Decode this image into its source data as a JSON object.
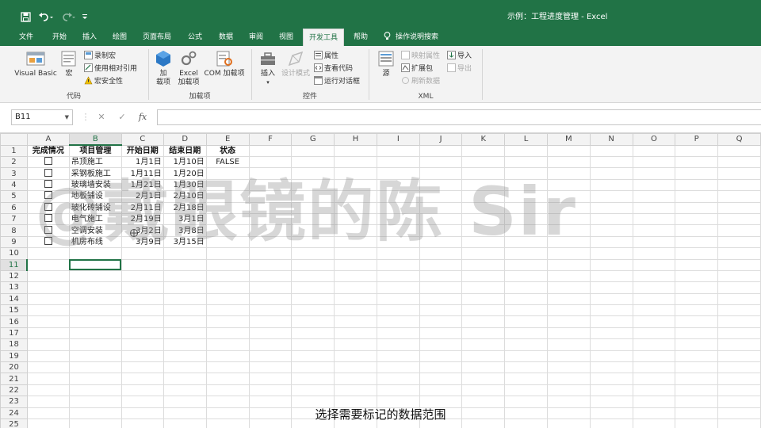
{
  "window": {
    "title": "示例：工程进度管理  -  Excel"
  },
  "tabs": [
    {
      "label": "文件"
    },
    {
      "label": "开始"
    },
    {
      "label": "插入"
    },
    {
      "label": "绘图"
    },
    {
      "label": "页面布局"
    },
    {
      "label": "公式"
    },
    {
      "label": "数据"
    },
    {
      "label": "审阅"
    },
    {
      "label": "视图"
    },
    {
      "label": "开发工具"
    },
    {
      "label": "帮助"
    }
  ],
  "tell_me": "操作说明搜索",
  "ribbon": {
    "code": {
      "label": "代码",
      "visual_basic": "Visual Basic",
      "macros": "宏",
      "record_macro": "录制宏",
      "relative_ref": "使用相对引用",
      "macro_security": "宏安全性"
    },
    "addins": {
      "label": "加载项",
      "addins_l1": "加",
      "addins_l2": "载项",
      "excel_addins_l1": "Excel",
      "excel_addins_l2": "加载项",
      "com_addins": "COM 加载项"
    },
    "controls": {
      "label": "控件",
      "insert": "插入",
      "design_mode": "设计模式",
      "properties": "属性",
      "view_code": "查看代码",
      "run_dialog": "运行对话框"
    },
    "xml": {
      "label": "XML",
      "source": "源",
      "map_props": "映射属性",
      "expansion_packs": "扩展包",
      "refresh_data": "刷新数据",
      "import": "导入",
      "export": "导出"
    }
  },
  "formula_bar": {
    "name_box": "B11",
    "fx": "fx",
    "value": ""
  },
  "sheet": {
    "columns": [
      "A",
      "B",
      "C",
      "D",
      "E",
      "F",
      "G",
      "H",
      "I",
      "J",
      "K",
      "L",
      "M",
      "N",
      "O",
      "P",
      "Q"
    ],
    "headers": [
      "完成情况",
      "项目管理",
      "开始日期",
      "结束日期",
      "状态"
    ],
    "rows": [
      {
        "task": "吊顶施工",
        "start": "1月1日",
        "end": "1月10日",
        "status": "FALSE"
      },
      {
        "task": "采钢板施工",
        "start": "1月11日",
        "end": "1月20日",
        "status": ""
      },
      {
        "task": "玻璃墙安装",
        "start": "1月21日",
        "end": "1月30日",
        "status": ""
      },
      {
        "task": "地板铺设",
        "start": "2月1日",
        "end": "2月10日",
        "status": ""
      },
      {
        "task": "玻化砖铺设",
        "start": "2月11日",
        "end": "2月18日",
        "status": ""
      },
      {
        "task": "电气施工",
        "start": "2月19日",
        "end": "3月1日",
        "status": ""
      },
      {
        "task": "空调安装",
        "start": "3月2日",
        "end": "3月8日",
        "status": ""
      },
      {
        "task": "机房布线",
        "start": "3月9日",
        "end": "3月15日",
        "status": ""
      }
    ],
    "row_numbers": [
      "1",
      "2",
      "3",
      "4",
      "5",
      "6",
      "7",
      "8",
      "9",
      "10",
      "11",
      "12",
      "13",
      "14",
      "15",
      "16",
      "17",
      "18",
      "19",
      "20",
      "21",
      "22",
      "23",
      "24",
      "25"
    ]
  },
  "watermark": "@戴眼镜的陈 Sir",
  "subtitle": "选择需要标记的数据范围",
  "colors": {
    "accent": "#217346",
    "ribbon_bg": "#f3f3f3"
  }
}
